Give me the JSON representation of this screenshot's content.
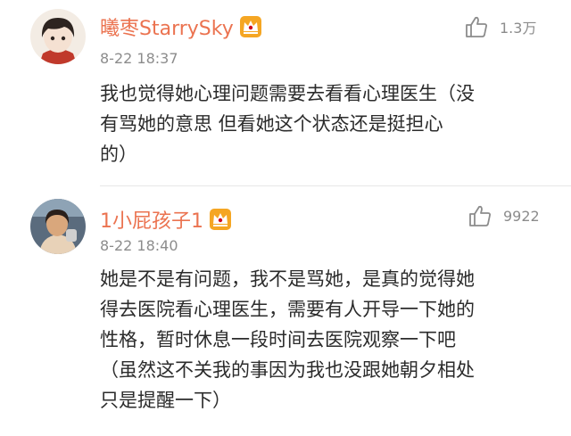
{
  "comments": [
    {
      "username": "曦枣StarrySky",
      "time": "8-22 18:37",
      "likes": "1.3万",
      "text": "我也觉得她心理问题需要去看看心理医生（没\n有骂她的意思 但看她这个状态还是挺担心\n的）",
      "badge_icon": "vip-crown-icon",
      "like_icon": "thumbs-up-icon"
    },
    {
      "username": "1小屁孩子1",
      "time": "8-22 18:40",
      "likes": "9922",
      "text": "她是不是有问题，我不是骂她，是真的觉得她\n得去医院看心理医生，需要有人开导一下她的\n性格，暂时休息一段时间去医院观察一下吧\n（虽然这不关我的事因为我也没跟她朝夕相处\n只是提醒一下）",
      "badge_icon": "vip-crown-icon",
      "like_icon": "thumbs-up-icon"
    }
  ],
  "colors": {
    "username": "#eb7350",
    "meta": "#8c8c8c",
    "text": "#2b2b2b",
    "badge": "#f5a623"
  }
}
